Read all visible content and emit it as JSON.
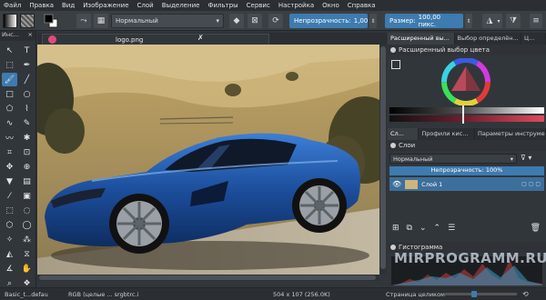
{
  "menu": [
    "Файл",
    "Правка",
    "Вид",
    "Изображение",
    "Слой",
    "Выделение",
    "Фильтры",
    "Сервис",
    "Настройка",
    "Окно",
    "Справка"
  ],
  "toolbar": {
    "blend_mode": "Нормальный",
    "opacity_label": "Непрозрачность:",
    "opacity_value": "1,00",
    "size_label": "Размер:",
    "size_value": "100,00 пикс."
  },
  "toolbox": {
    "title": "Инс...",
    "tool_count": 34
  },
  "document": {
    "tab_title": "logo.png"
  },
  "right": {
    "tabs_top": [
      "Расширенный вы...",
      "Выбор определён...",
      "Ц..."
    ],
    "color_selector_title": "Расширенный выбор цвета",
    "tabs_mid": [
      "Сл...",
      "Профили кис...",
      "Параметры инструме..."
    ],
    "layers": {
      "title": "Слои",
      "blend": "Нормальный",
      "opacity": "Непрозрачность: 100%",
      "layer_name": "Слой 1"
    },
    "histogram_title": "Гистограмма"
  },
  "status": {
    "brush": "Basic_t...defau",
    "colorspace": "RGB (целые ... srgbtrc.i",
    "dimensions": "504 x 107 (256.0K)",
    "zoom": "Страница целиком"
  },
  "watermark": "MIRPROGRAMM.RU",
  "colors": {
    "accent": "#3d7bb0",
    "bg": "#31363b",
    "car": "#1c4e9c"
  }
}
